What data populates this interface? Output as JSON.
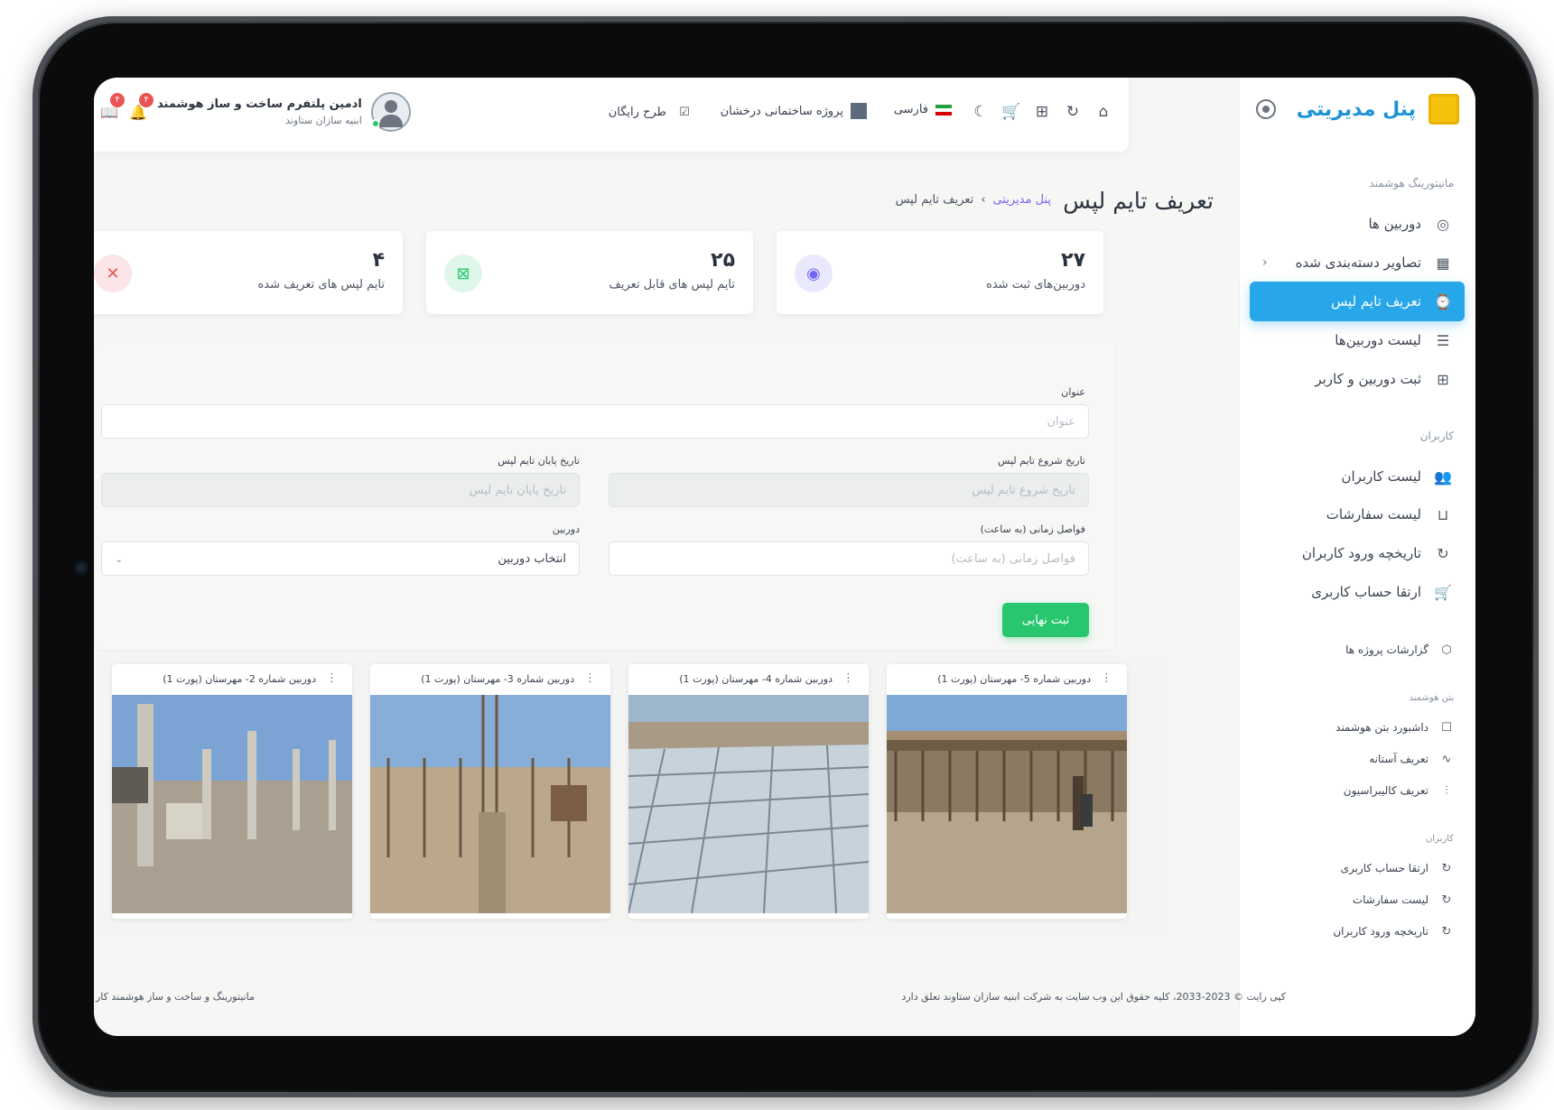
{
  "sidebar": {
    "title": "پنل مدیریتی",
    "section1": "مانیتورینگ هوشمند",
    "items": [
      {
        "label": "دوربین ها",
        "icon": "camera-icon"
      },
      {
        "label": "تصاویر دسته‌بندی شده",
        "icon": "grid-icon"
      },
      {
        "label": "تعریف تایم لپس",
        "icon": "timer-icon"
      },
      {
        "label": "لیست دوربین‌ها",
        "icon": "list-icon"
      },
      {
        "label": "ثبت دوربین و کاربر",
        "icon": "plus-square-icon"
      }
    ],
    "section2": "کاربران",
    "items2": [
      {
        "label": "لیست کاربران",
        "icon": "users-icon"
      },
      {
        "label": "لیست سفارشات",
        "icon": "bag-icon"
      },
      {
        "label": "تاریخچه ورود کاربران",
        "icon": "refresh-icon"
      },
      {
        "label": "ارتقا حساب کاربری",
        "icon": "cart-icon"
      }
    ],
    "reports": "گزارشات پروژه ها",
    "section3": "بتن هوشمند",
    "items3": [
      {
        "label": "داشبورد بتن هوشمند",
        "icon": "square-icon"
      },
      {
        "label": "تعریف آستانه",
        "icon": "activity-icon"
      },
      {
        "label": "تعریف کالیبراسیون",
        "icon": "sliders-icon"
      }
    ],
    "section4": "کاربران",
    "items4": [
      {
        "label": "ارتقا حساب کاربری",
        "icon": "refresh-icon"
      },
      {
        "label": "لیست سفارشات",
        "icon": "refresh-icon"
      },
      {
        "label": "تاریخچه ورود کاربران",
        "icon": "refresh-icon"
      }
    ]
  },
  "topbar": {
    "language": "فارسی",
    "project": "پروژه ساختمانی درخشان",
    "plan": "طرح رایگان",
    "user_name": "ادمین پلتفرم ساخت و ساز هوشمند",
    "user_company": "ابنیه سازان ستاوند",
    "badge_notifications": "۴",
    "badge_messages": "۴"
  },
  "page": {
    "title": "تعریف تایم لپس",
    "crumb_home": "پنل مدیریتی",
    "crumb_current": "تعریف تایم لپس"
  },
  "stats": [
    {
      "value": "۲۷",
      "label": "دوربین‌های ثبت شده"
    },
    {
      "value": "۲۵",
      "label": "تایم لپس های قابل تعریف"
    },
    {
      "value": "۴",
      "label": "تایم لپس های تعریف شده"
    }
  ],
  "form": {
    "title_label": "عنوان",
    "title_placeholder": "عنوان",
    "start_label": "تاریخ شروع تایم لپس",
    "start_placeholder": "تاریخ شروع تایم لپس",
    "end_label": "تاریخ پایان تایم لپس",
    "end_placeholder": "تاریخ پایان تایم لپس",
    "interval_label": "فواصل زمانی (به ساعت)",
    "interval_placeholder": "فواصل زمانی (به ساعت)",
    "camera_label": "دوربین",
    "camera_selected": "انتخاب دوربین",
    "submit": "ثبت نهایی"
  },
  "cameras": [
    {
      "title": "دوربین شماره 5- مهرستان (پورت 1)"
    },
    {
      "title": "دوربین شماره 4- مهرستان (پورت 1)"
    },
    {
      "title": "دوربین شماره 3- مهرستان (پورت 1)"
    },
    {
      "title": "دوربین شماره 2- مهرستان (پورت 1)"
    }
  ],
  "footer": {
    "copyright": "کپی رایت © 2023-2033، کلیه حقوق این وب سایت به شرکت ابنیه سازان ستاوند تعلق دارد",
    "tagline": "مانیتورینگ و ساخت و ساز هوشمند کار"
  },
  "colors": {
    "accent": "#27a7ea",
    "success": "#28c76f",
    "danger": "#ea5455",
    "brand_title": "#1b93d6"
  }
}
